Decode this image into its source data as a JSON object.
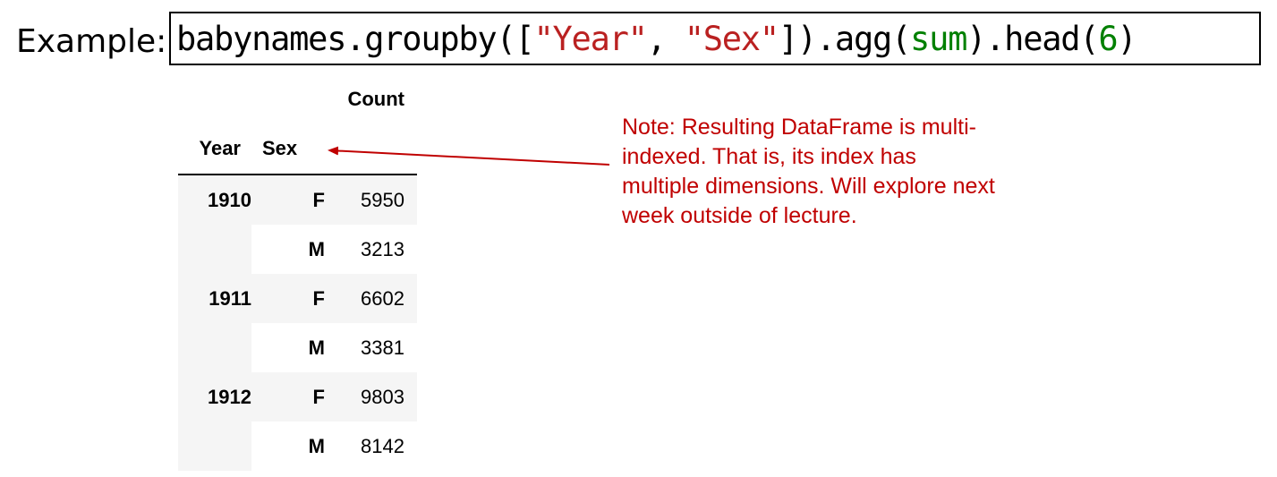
{
  "example_label": "Example:",
  "code": {
    "prefix": "babynames.groupby([",
    "str1": "\"Year\"",
    "sep": ", ",
    "str2": "\"Sex\"",
    "mid": "]).agg(",
    "builtin": "sum",
    "after_builtin": ").head(",
    "num": "6",
    "suffix": ")"
  },
  "table": {
    "column_header": "Count",
    "index_names": [
      "Year",
      "Sex"
    ],
    "rows": [
      {
        "year": "1910",
        "sex": "F",
        "count": "5950"
      },
      {
        "year": "",
        "sex": "M",
        "count": "3213"
      },
      {
        "year": "1911",
        "sex": "F",
        "count": "6602"
      },
      {
        "year": "",
        "sex": "M",
        "count": "3381"
      },
      {
        "year": "1912",
        "sex": "F",
        "count": "9803"
      },
      {
        "year": "",
        "sex": "M",
        "count": "8142"
      }
    ]
  },
  "note": "Note: Resulting DataFrame is multi-indexed. That is, its index has multiple dimensions. Will explore next week outside of lecture.",
  "colors": {
    "note": "#c00000",
    "code_string": "#ba2121",
    "code_builtin": "#008000",
    "row_shade": "#f5f5f5"
  }
}
